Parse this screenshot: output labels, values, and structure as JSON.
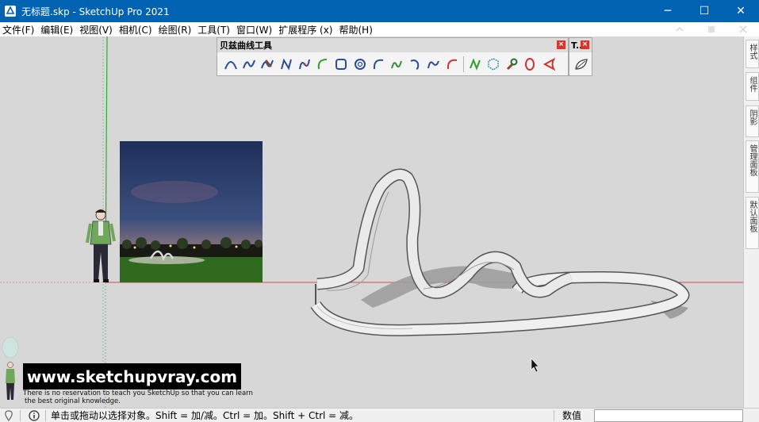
{
  "window": {
    "title": "无标题.skp - SketchUp Pro 2021",
    "minimize": "─",
    "maximize": "☐",
    "close": "✕"
  },
  "menu": [
    "文件(F)",
    "编辑(E)",
    "视图(V)",
    "相机(C)",
    "绘图(R)",
    "工具(T)",
    "窗口(W)",
    "扩展程序 (x)",
    "帮助(H)"
  ],
  "toolbar": {
    "title": "贝兹曲线工具",
    "close": "×"
  },
  "toolbar2": {
    "title": "T..",
    "close": "×"
  },
  "tray": {
    "tabs": [
      "样式",
      "组件",
      "阴影",
      "管理面板",
      "默认面板"
    ]
  },
  "watermark": {
    "url": "www.sketchupvray.com",
    "line1": "There is no reservation to teach you SketchUp so that you can learn",
    "line2": "the best original knowledge."
  },
  "status": {
    "message": "单击或拖动以选择对象。Shift = 加/减。Ctrl = 加。Shift + Ctrl = 减。",
    "value_label": "数值",
    "value": ""
  },
  "colors": {
    "titlebar": "#0063b1",
    "viewport": "#d7d7d7",
    "axis_red": "#d94a4a",
    "axis_green": "#34a634",
    "close_red": "#d9342b"
  }
}
